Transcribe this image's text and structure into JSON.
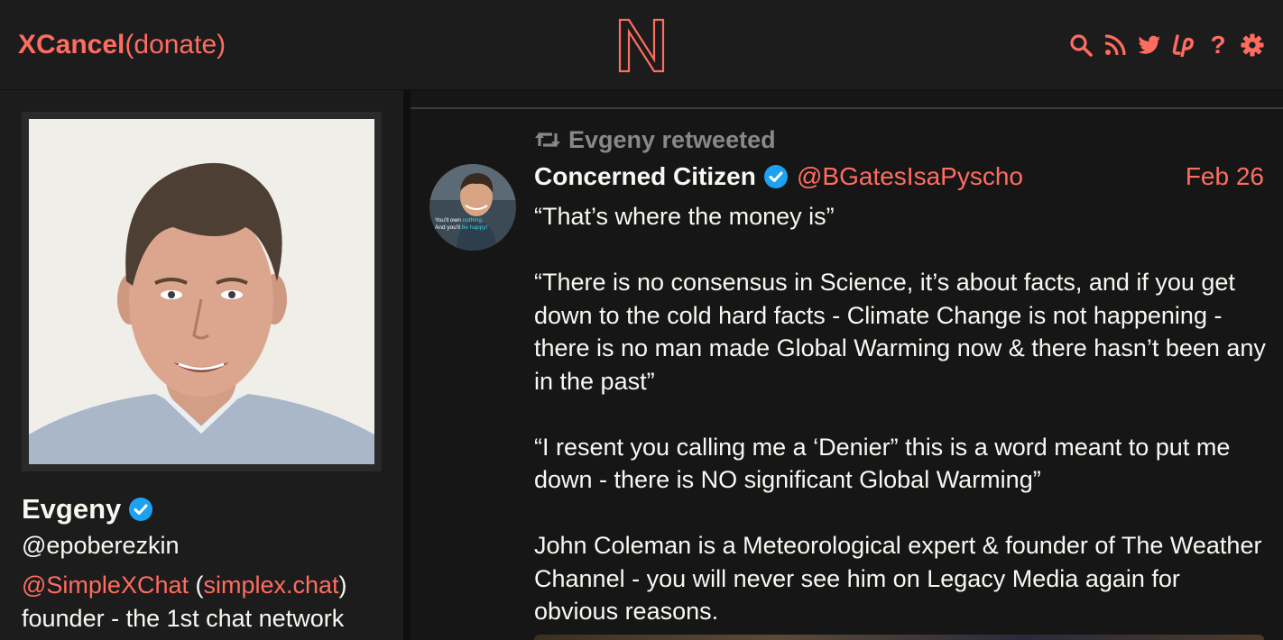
{
  "brand": {
    "name": "XCancel",
    "donate": "(donate)"
  },
  "colors": {
    "accent": "#ff6c60",
    "verified": "#1da1f2",
    "bg": "#161616",
    "panel": "#1c1c1c",
    "muted": "#888889"
  },
  "nav": {
    "icons": [
      "search-icon",
      "rss-icon",
      "twitter-icon",
      "liberapay-icon",
      "help-icon",
      "settings-icon"
    ],
    "help_label": "?"
  },
  "profile": {
    "fullname": "Evgeny",
    "username": "@epoberezkin",
    "bio": {
      "link1": "@SimpleXChat",
      "open_paren": " (",
      "link2": "simplex.chat",
      "close_paren": ")",
      "line2": "founder - the 1st chat network"
    }
  },
  "tweet": {
    "retweet_label": "Evgeny retweeted",
    "fullname": "Concerned Citizen",
    "username": "@BGatesIsaPyscho",
    "date": "Feb 26",
    "avatar_text": {
      "line1a": "You'll own ",
      "line1b": "nothing.",
      "line2a": "And you'll ",
      "line2b": "be happy!"
    },
    "paragraphs": [
      "“That’s where the money is”",
      "“There is no consensus in Science, it’s about facts, and if you get down to the cold hard facts - Climate Change is not happening - there is no man made Global Warming now & there hasn’t been any in the past”",
      "“I resent you calling me a ‘Denier” this is a word meant to put me down - there is NO significant Global Warming”",
      "John Coleman is a Meteorological expert & founder of The Weather Channel - you will never see him on Legacy Media again for obvious reasons."
    ]
  }
}
